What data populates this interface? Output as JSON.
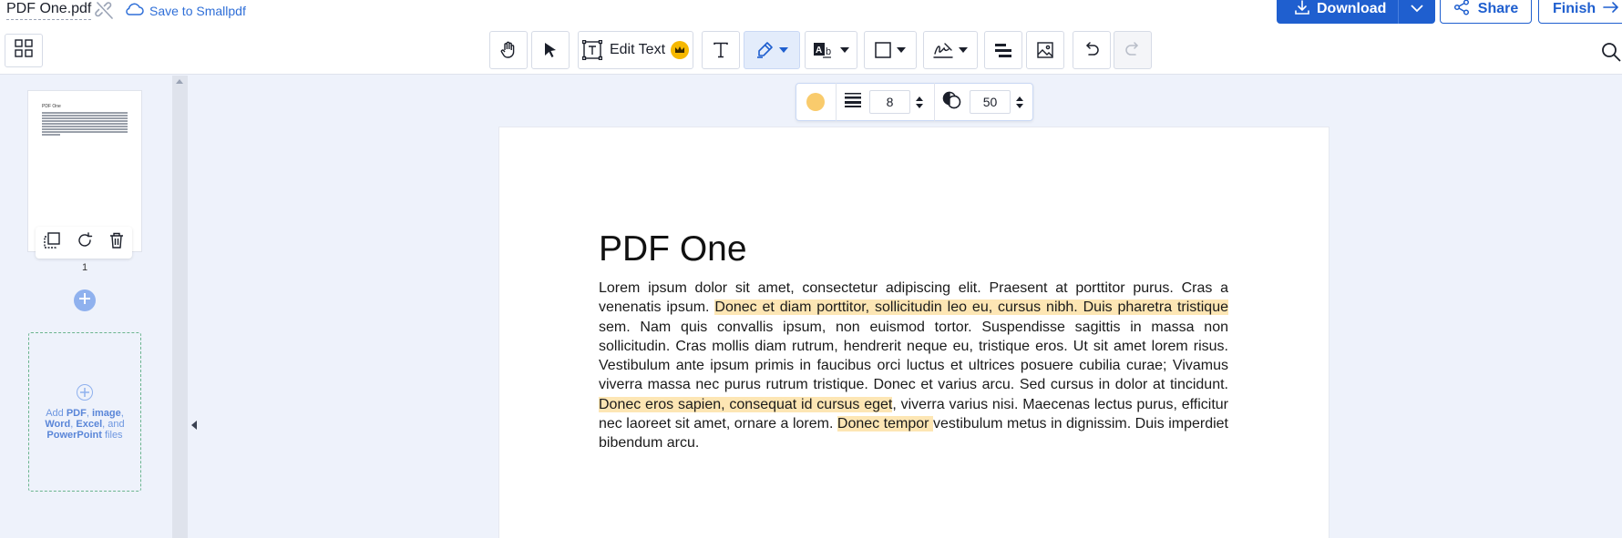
{
  "header": {
    "filename": "PDF One.pdf",
    "save_link": "Save to Smallpdf",
    "download_label": "Download",
    "share_label": "Share",
    "finish_label": "Finish"
  },
  "toolbar": {
    "tools": [
      {
        "name": "hand-tool",
        "icon": "hand-icon"
      },
      {
        "name": "select-tool",
        "icon": "cursor-icon"
      },
      {
        "name": "edit-text-tool",
        "label": "Edit Text",
        "icon": "edit-text-icon",
        "badge": "crown-icon"
      },
      {
        "name": "add-text-tool",
        "icon": "text-icon"
      },
      {
        "name": "highlight-tool",
        "icon": "highlighter-icon",
        "active": true
      },
      {
        "name": "text-markup-tool",
        "icon": "text-markup-icon"
      },
      {
        "name": "shape-tool",
        "icon": "rectangle-icon"
      },
      {
        "name": "signature-tool",
        "icon": "signature-icon"
      },
      {
        "name": "whiteout-tool",
        "icon": "whiteout-icon"
      },
      {
        "name": "image-tool",
        "icon": "image-icon"
      },
      {
        "name": "undo",
        "icon": "undo-icon"
      },
      {
        "name": "redo",
        "icon": "redo-icon",
        "disabled": true
      }
    ],
    "edit_text_label": "Edit Text"
  },
  "highlight_options": {
    "color": "#f9cb6c",
    "thickness": "8",
    "opacity": "50"
  },
  "sidebar": {
    "page_number": "1",
    "thumbnail_title": "PDF One",
    "dropzone": {
      "prefix": "Add ",
      "pdf": "PDF",
      "sep1": ", ",
      "image": "image",
      "sep2": ", ",
      "word": "Word",
      "sep3": ", ",
      "excel": "Excel",
      "sep4": ", and ",
      "powerpoint": "PowerPoint",
      "suffix": " files"
    }
  },
  "document": {
    "title": "PDF One",
    "body_segments": [
      {
        "text": "Lorem ipsum dolor sit amet, consectetur adipiscing elit. Praesent at porttitor purus. Cras a venenatis ipsum. ",
        "highlighted": false
      },
      {
        "text": "Donec et diam porttitor, sollicitudin leo eu, cursus nibh. Duis pharetra tristique",
        "highlighted": true
      },
      {
        "text": " sem. Nam quis convallis ipsum, non euismod tortor. Suspendisse sagittis in massa non sollicitudin. Cras mollis diam rutrum, hendrerit neque eu, tristique eros. Ut sit amet lorem risus. Vestibulum ante ipsum primis in faucibus orci luctus et ultrices posuere cubilia curae; Vivamus viverra massa nec purus rutrum tristique. Donec et varius arcu. Sed cursus in dolor at tincidunt. ",
        "highlighted": false
      },
      {
        "text": "Donec eros sapien, consequat id cursus eget",
        "highlighted": true
      },
      {
        "text": ", viverra varius nisi. Maecenas lectus purus, efficitur nec laoreet sit amet, ornare a lorem. ",
        "highlighted": false
      },
      {
        "text": "Donec tempor ",
        "highlighted": true
      },
      {
        "text": "vestibulum metus in dignissim. Duis imperdiet bibendum arcu.",
        "highlighted": false
      }
    ]
  },
  "colors": {
    "accent": "#1f5fcf",
    "highlight": "#fde6b4",
    "canvas": "#eef2fb"
  }
}
